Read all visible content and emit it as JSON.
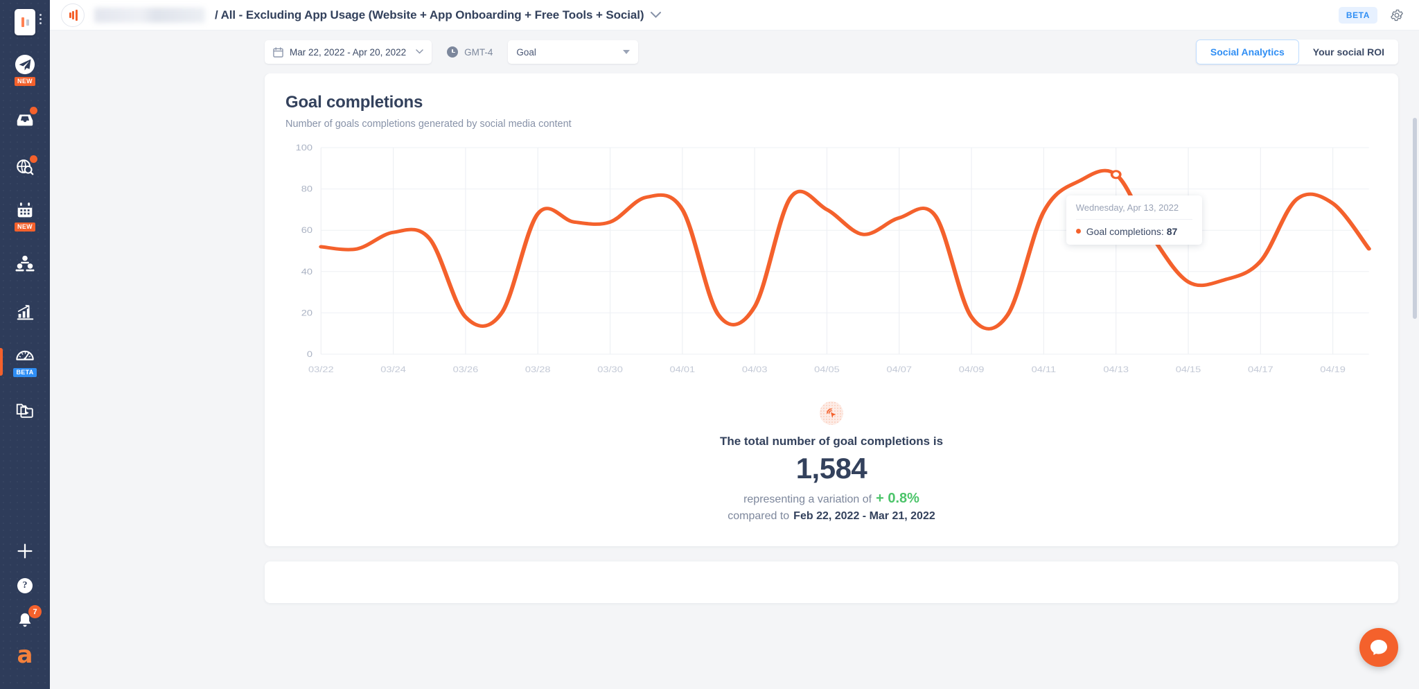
{
  "sidebar": {
    "logo_name": "agorapulse-logo",
    "items": [
      {
        "name": "publish",
        "icon": "paper-plane-icon",
        "badge": "NEW",
        "alert": false,
        "active": false
      },
      {
        "name": "inbox",
        "icon": "inbox-icon",
        "badge": "",
        "alert": true,
        "active": false
      },
      {
        "name": "listening",
        "icon": "globe-search-icon",
        "badge": "",
        "alert": true,
        "active": false
      },
      {
        "name": "calendar",
        "icon": "calendar-icon",
        "badge": "NEW",
        "alert": false,
        "active": false
      },
      {
        "name": "audience",
        "icon": "users-icon",
        "badge": "",
        "alert": false,
        "active": false
      },
      {
        "name": "reports",
        "icon": "bar-chart-arrow-icon",
        "badge": "",
        "alert": false,
        "active": false
      },
      {
        "name": "roi-dashboard",
        "icon": "gauge-icon",
        "badge": "BETA",
        "alert": false,
        "active": true
      },
      {
        "name": "media-library",
        "icon": "media-folder-icon",
        "badge": "",
        "alert": false,
        "active": false
      }
    ],
    "bottom": {
      "add_label": "+",
      "help_label": "?",
      "notifications_count": "7",
      "avatar_label": "a"
    }
  },
  "topbar": {
    "profile_icon": "bar-chart-icon",
    "workspace_name": "",
    "title": "/ All - Excluding App Usage (Website + App Onboarding + Free Tools + Social)",
    "caret": "∨",
    "beta_label": "BETA",
    "settings_icon": "gear-icon"
  },
  "toolbar": {
    "date_range": "Mar 22, 2022 - Apr 20, 2022",
    "timezone": "GMT-4",
    "goal_select_value": "Goal",
    "tabs": [
      {
        "label": "Social Analytics",
        "active": true
      },
      {
        "label": "Your social ROI",
        "active": false
      }
    ]
  },
  "card": {
    "title": "Goal completions",
    "subtitle": "Number of goals completions generated by social media content"
  },
  "tooltip": {
    "date": "Wednesday, Apr 13, 2022",
    "series_label": "Goal completions:",
    "value": "87"
  },
  "summary": {
    "icon": "click-target-icon",
    "line1": "The total number of goal completions is",
    "total": "1,584",
    "variation_prefix": "representing a variation of",
    "variation": "+ 0.8%",
    "compare_prefix": "compared to",
    "compare_range": "Feb 22, 2022 - Mar 21, 2022",
    "variation_color": "#4cc46a"
  },
  "chart_data": {
    "type": "line",
    "title": "Goal completions",
    "subtitle": "Number of goals completions generated by social media content",
    "xlabel": "",
    "ylabel": "",
    "ylim": [
      0,
      100
    ],
    "yticks": [
      0,
      20,
      40,
      60,
      80,
      100
    ],
    "xticks": [
      "03/22",
      "03/24",
      "03/26",
      "03/28",
      "03/30",
      "04/01",
      "04/03",
      "04/05",
      "04/07",
      "04/09",
      "04/11",
      "04/13",
      "04/15",
      "04/17",
      "04/19"
    ],
    "grid": true,
    "legend": false,
    "line_color": "#f4612c",
    "highlight_point": {
      "x": "04/13",
      "y": 87
    },
    "x": [
      "03/22",
      "03/23",
      "03/24",
      "03/25",
      "03/26",
      "03/27",
      "03/28",
      "03/29",
      "03/30",
      "03/31",
      "04/01",
      "04/02",
      "04/03",
      "04/04",
      "04/05",
      "04/06",
      "04/07",
      "04/08",
      "04/09",
      "04/10",
      "04/11",
      "04/12",
      "04/13",
      "04/14",
      "04/15",
      "04/16",
      "04/17",
      "04/18",
      "04/19",
      "04/20"
    ],
    "series": [
      {
        "name": "Goal completions",
        "values": [
          52,
          51,
          59,
          56,
          18,
          20,
          68,
          64,
          64,
          76,
          70,
          19,
          23,
          76,
          70,
          58,
          66,
          67,
          18,
          19,
          69,
          84,
          87,
          57,
          35,
          36,
          45,
          75,
          73,
          51
        ]
      }
    ]
  }
}
